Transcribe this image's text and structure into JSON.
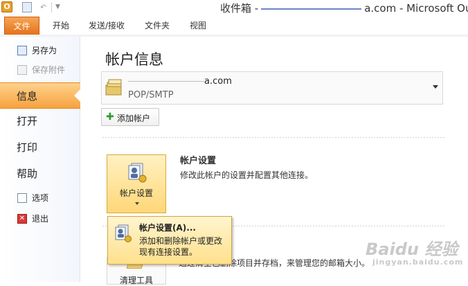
{
  "window": {
    "title_prefix": "收件箱 -",
    "title_suffix": "a.com - Microsoft Outlo"
  },
  "ribbon": {
    "tabs": [
      "文件",
      "开始",
      "发送/接收",
      "文件夹",
      "视图"
    ]
  },
  "nav": {
    "save_as": "另存为",
    "save_attachments": "保存附件",
    "info": "信息",
    "open": "打开",
    "print": "打印",
    "help": "帮助",
    "options": "选项",
    "exit": "退出"
  },
  "main": {
    "page_title": "帐户信息",
    "account_email_suffix": "a.com",
    "account_type": "POP/SMTP",
    "add_account": "添加帐户",
    "account_settings_button": "帐户设置",
    "account_settings_title": "帐户设置",
    "account_settings_desc": "修改此帐户的设置并配置其他连接。",
    "cleanup_button": "清理工具",
    "cleanup_desc": "通过清空已删除项目并存档，来管理您的邮箱大小。"
  },
  "dropdown": {
    "item_title": "帐户设置(A)...",
    "item_desc": "添加和删除帐户或更改现有连接设置。"
  },
  "watermark": {
    "logo": "Baidu 经验",
    "sub": "jingyan.baidu.com"
  },
  "colors": {
    "file_tab": "#e5701a",
    "active_nav": "#f6a23f",
    "highlight": "#ffd777"
  }
}
